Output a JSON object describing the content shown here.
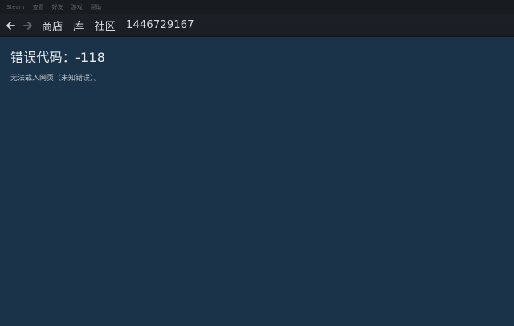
{
  "menu": {
    "items": [
      "Steam",
      "查看",
      "好友",
      "游戏",
      "帮助"
    ]
  },
  "nav": {
    "store": "商店",
    "library": "库",
    "community": "社区",
    "username": "1446729167"
  },
  "error": {
    "title": "错误代码：-118",
    "message": "无法载入网页（未知错误）。"
  },
  "colors": {
    "background": "#1b3349",
    "menubar": "#181b20",
    "navbar": "#1d2127"
  }
}
